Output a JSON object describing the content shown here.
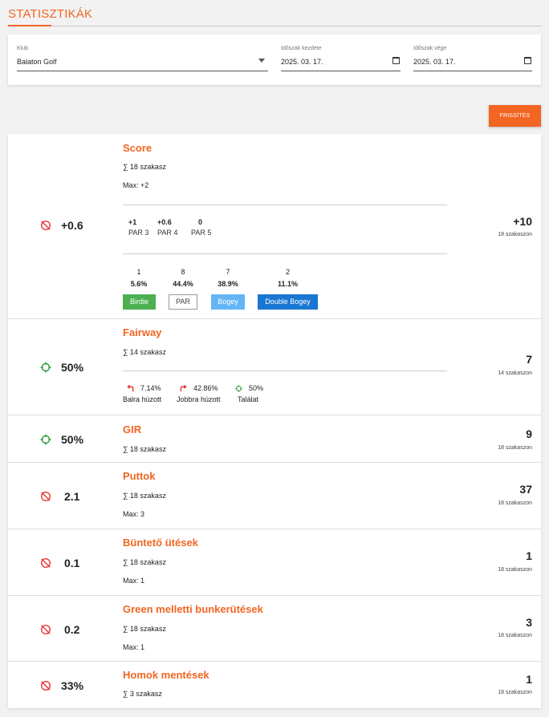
{
  "header": {
    "title": "STATISZTIKÁK"
  },
  "filters": {
    "club": {
      "label": "Klub",
      "value": "Balaton Golf"
    },
    "start": {
      "label": "Időszak kezdete",
      "value": "2025. 03. 17."
    },
    "end": {
      "label": "Időszak vége",
      "value": "2025. 03. 17."
    }
  },
  "refresh_label": "FRISSÍTÉS",
  "colors": {
    "accent": "#f26522",
    "birdie": "#4caf50",
    "bogey": "#64b5f6",
    "double_bogey": "#1976d2",
    "hit": "#2e9e3e",
    "miss": "#e53935"
  },
  "score": {
    "title": "Score",
    "holes": "∑ 18 szakasz",
    "max": "Max: +2",
    "avg": "+0.6",
    "total": "+10",
    "total_sub": "18 szakaszon",
    "pars": [
      {
        "value": "+1",
        "label": "PAR 3"
      },
      {
        "value": "+0.6",
        "label": "PAR 4"
      },
      {
        "value": "0",
        "label": "PAR 5"
      }
    ],
    "dist": [
      {
        "count": "1",
        "pct": "5.6%",
        "label": "Birdie"
      },
      {
        "count": "8",
        "pct": "44.4%",
        "label": "PAR"
      },
      {
        "count": "7",
        "pct": "38.9%",
        "label": "Bogey"
      },
      {
        "count": "2",
        "pct": "11.1%",
        "label": "Double Bogey"
      }
    ]
  },
  "fairway": {
    "title": "Fairway",
    "holes": "∑ 14 szakasz",
    "avg": "50%",
    "total": "7",
    "total_sub": "14 szakaszon",
    "items": [
      {
        "pct": "7.14%",
        "label": "Balra húzott"
      },
      {
        "pct": "42.86%",
        "label": "Jobbra húzott"
      },
      {
        "pct": "50%",
        "label": "Találat"
      }
    ]
  },
  "gir": {
    "title": "GIR",
    "holes": "∑ 18 szakasz",
    "avg": "50%",
    "total": "9",
    "total_sub": "18 szakaszon"
  },
  "putts": {
    "title": "Puttok",
    "holes": "∑ 18 szakasz",
    "max": "Max: 3",
    "avg": "2.1",
    "total": "37",
    "total_sub": "18 szakaszon"
  },
  "penalties": {
    "title": "Büntető ütések",
    "holes": "∑ 18 szakasz",
    "max": "Max: 1",
    "avg": "0.1",
    "total": "1",
    "total_sub": "18 szakaszon"
  },
  "bunker": {
    "title": "Green melletti bunkerütések",
    "holes": "∑ 18 szakasz",
    "max": "Max: 1",
    "avg": "0.2",
    "total": "3",
    "total_sub": "18 szakaszon"
  },
  "sand": {
    "title": "Homok mentések",
    "holes": "∑ 3 szakasz",
    "avg": "33%",
    "total": "1",
    "total_sub": "18 szakaszon"
  }
}
